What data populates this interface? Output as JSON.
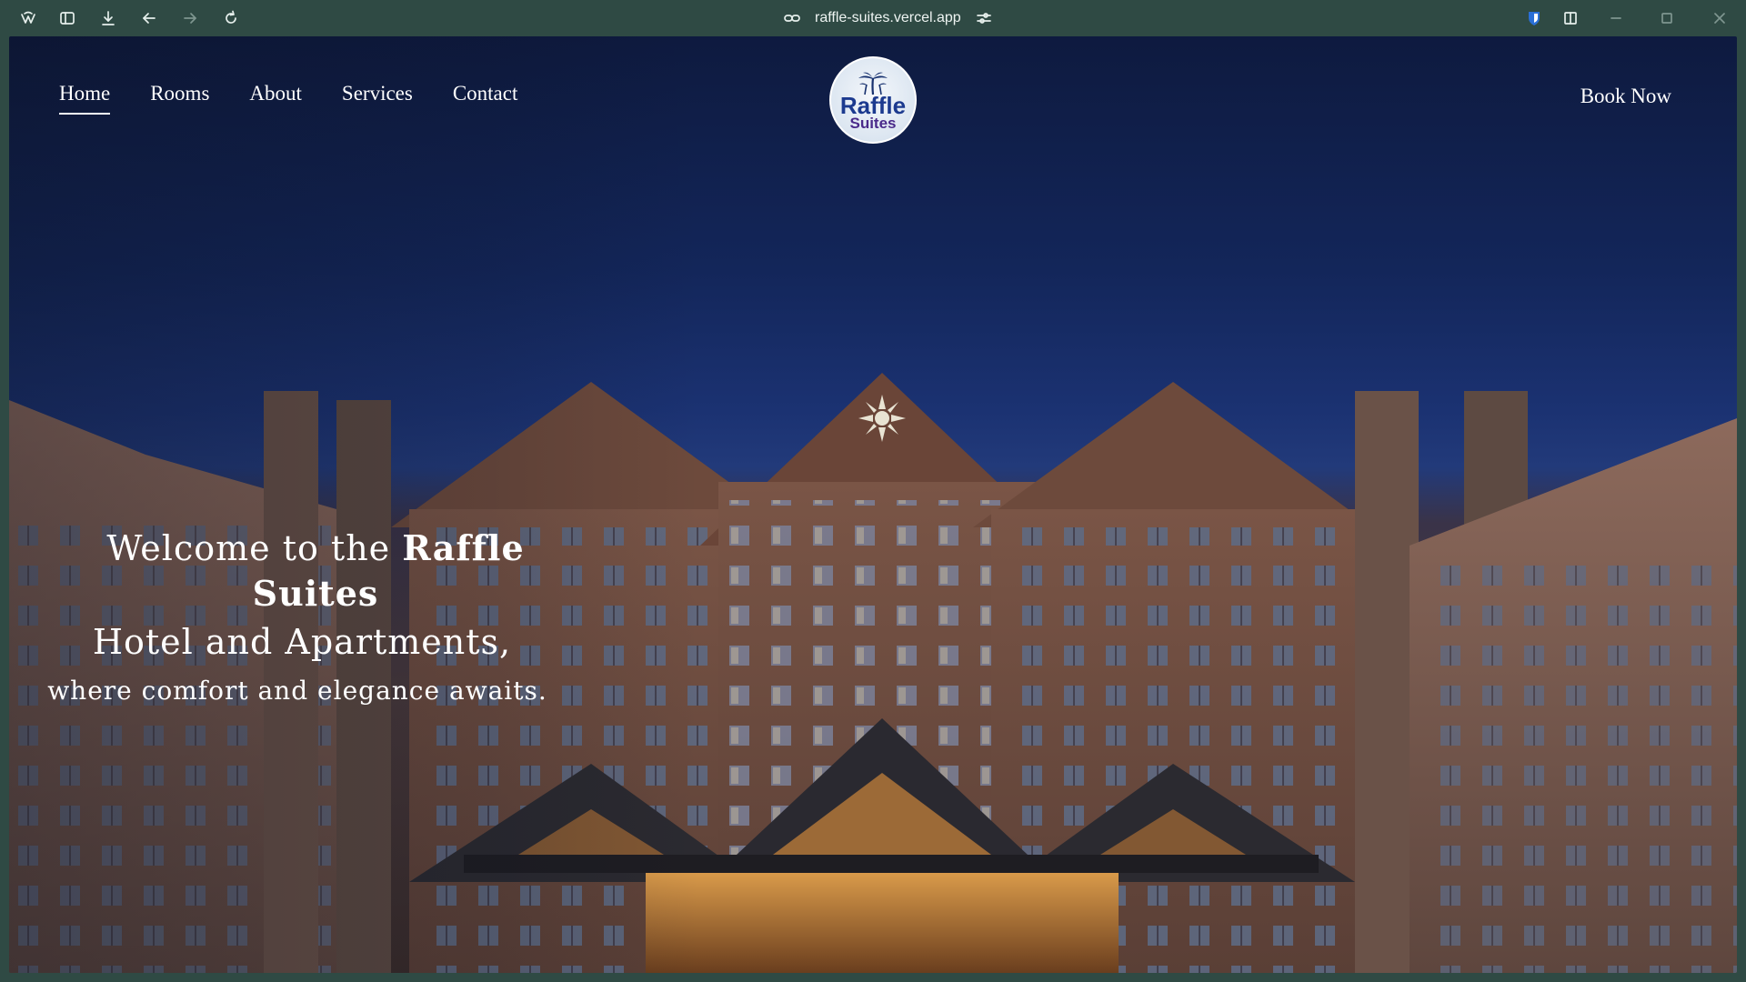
{
  "browser": {
    "url": "raffle-suites.vercel.app",
    "icons": [
      "app-logo-icon",
      "sidebar-toggle-icon",
      "download-icon",
      "back-icon",
      "forward-icon",
      "reload-icon",
      "link-icon",
      "site-settings-icon",
      "bitwarden-shield-icon",
      "split-view-icon",
      "minimize-icon",
      "maximize-icon",
      "close-icon"
    ]
  },
  "nav": {
    "items": [
      {
        "label": "Home",
        "active": true
      },
      {
        "label": "Rooms"
      },
      {
        "label": "About"
      },
      {
        "label": "Services"
      },
      {
        "label": "Contact"
      }
    ]
  },
  "logo": {
    "line1": "Raffle",
    "line2": "Suites"
  },
  "cta": {
    "book_label": "Book Now"
  },
  "hero": {
    "prefix": "Welcome to the ",
    "brand": "Raffle Suites",
    "line2": "Hotel and Apartments,",
    "line3": "where comfort and elegance awaits."
  },
  "colors": {
    "chrome": "#2f4a44",
    "sky_top": "#0e1a3f",
    "sky_bottom": "#223a7a",
    "logo_blue": "#1c3a8f",
    "logo_purple": "#4a2a8a"
  }
}
